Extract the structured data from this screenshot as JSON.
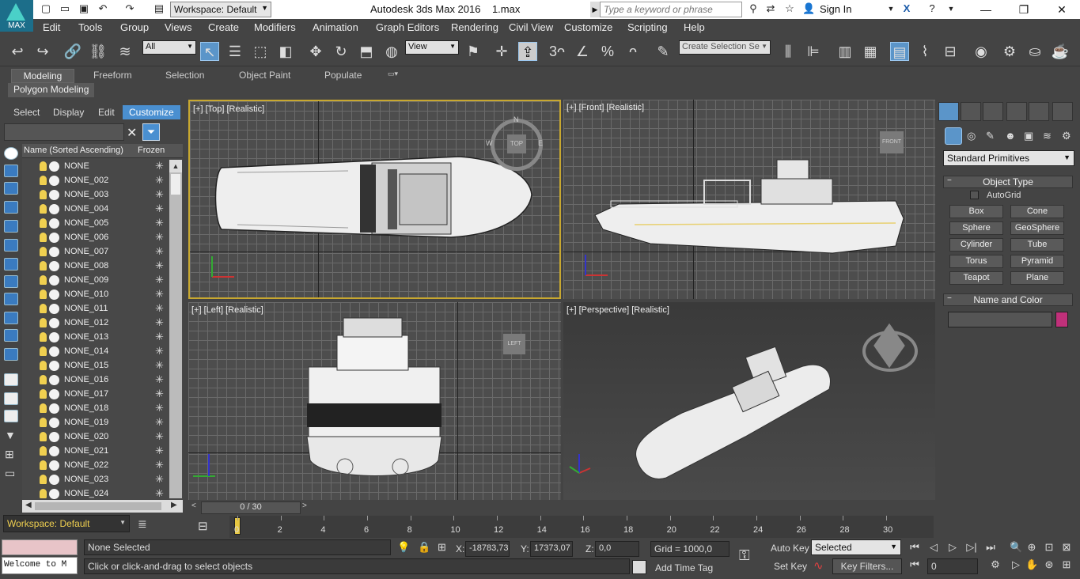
{
  "app": {
    "title": "Autodesk 3ds Max 2016",
    "file": "1.max",
    "logo_text": "MAX"
  },
  "workspace_label": "Workspace: Default",
  "search_placeholder": "Type a keyword or phrase",
  "sign_in": "Sign In",
  "menu": [
    "Edit",
    "Tools",
    "Group",
    "Views",
    "Create",
    "Modifiers",
    "Animation",
    "Graph Editors",
    "Rendering",
    "Civil View",
    "Customize",
    "Scripting",
    "Help"
  ],
  "toolbar": {
    "filter_value": "All",
    "view_value": "View",
    "selection_set_placeholder": "Create Selection Se"
  },
  "ribbon": {
    "tabs": [
      "Modeling",
      "Freeform",
      "Selection",
      "Object Paint",
      "Populate"
    ],
    "sub": "Polygon Modeling"
  },
  "scene_explorer": {
    "tabs": [
      "Select",
      "Display",
      "Edit",
      "Customize"
    ],
    "col_name": "Name (Sorted Ascending)",
    "col_frozen": "Frozen",
    "items": [
      "NONE",
      "NONE_002",
      "NONE_003",
      "NONE_004",
      "NONE_005",
      "NONE_006",
      "NONE_007",
      "NONE_008",
      "NONE_009",
      "NONE_010",
      "NONE_011",
      "NONE_012",
      "NONE_013",
      "NONE_014",
      "NONE_015",
      "NONE_016",
      "NONE_017",
      "NONE_018",
      "NONE_019",
      "NONE_020",
      "NONE_021",
      "NONE_022",
      "NONE_023",
      "NONE_024"
    ]
  },
  "viewports": {
    "top": "[+] [Top] [Realistic]",
    "front": "[+] [Front] [Realistic]",
    "left": "[+] [Left] [Realistic]",
    "persp": "[+] [Perspective] [Realistic]",
    "cube_top": "TOP",
    "cube_front": "FRONT",
    "cube_left": "LEFT",
    "compass_n": "N",
    "compass_w": "W",
    "compass_e": "E"
  },
  "command_panel": {
    "category": "Standard Primitives",
    "object_type": "Object Type",
    "autogrid": "AutoGrid",
    "buttons": [
      "Box",
      "Cone",
      "Sphere",
      "GeoSphere",
      "Cylinder",
      "Tube",
      "Torus",
      "Pyramid",
      "Teapot",
      "Plane"
    ],
    "name_color": "Name and Color",
    "swatch_color": "#c0307a"
  },
  "timeline": {
    "slider": "0 / 30",
    "ticks": [
      "0",
      "2",
      "4",
      "6",
      "8",
      "10",
      "12",
      "14",
      "16",
      "18",
      "20",
      "22",
      "24",
      "26",
      "28",
      "30"
    ]
  },
  "status": {
    "selection": "None Selected",
    "prompt": "Click or click-and-drag to select objects",
    "maxscript": "Welcome to M",
    "x_label": "X:",
    "x": "-18783,73",
    "y_label": "Y:",
    "y": "17373,07",
    "z_label": "Z:",
    "z": "0,0",
    "grid": "Grid = 1000,0",
    "add_time_tag": "Add Time Tag",
    "auto_key": "Auto Key",
    "set_key": "Set Key",
    "key_mode": "Selected",
    "key_filters": "Key Filters...",
    "frame": "0"
  }
}
